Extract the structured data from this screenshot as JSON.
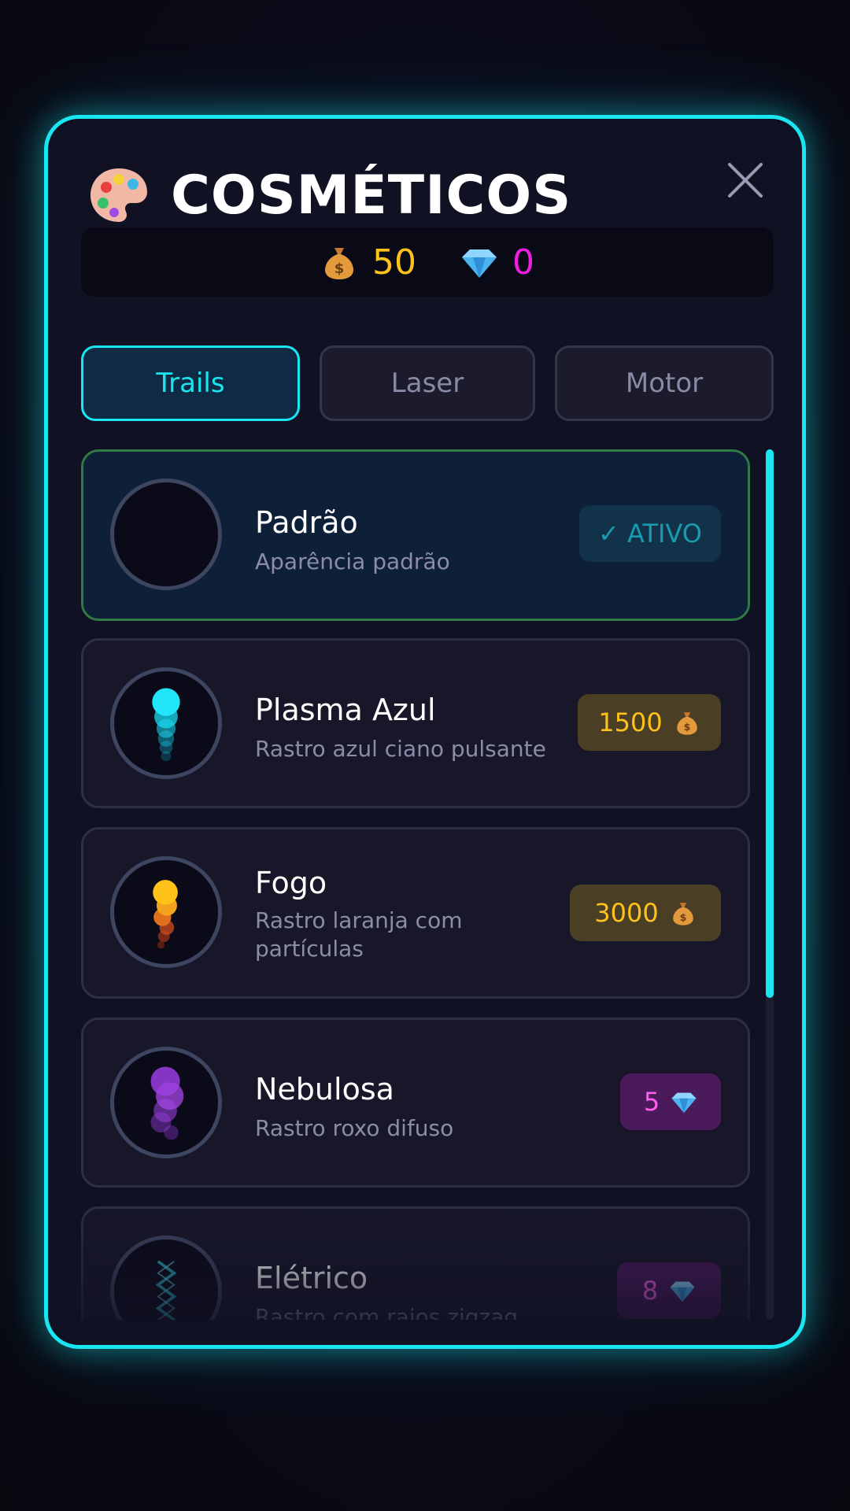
{
  "header": {
    "title": "COSMÉTICOS",
    "icon": "palette-icon",
    "close_icon": "close-icon"
  },
  "currency": {
    "coins": "50",
    "coins_icon": "money-bag-icon",
    "gems": "0",
    "gems_icon": "gem-icon"
  },
  "tabs": [
    {
      "label": "Trails",
      "active": true
    },
    {
      "label": "Laser",
      "active": false
    },
    {
      "label": "Motor",
      "active": false
    }
  ],
  "items": [
    {
      "name": "Padrão",
      "desc": "Aparência padrão",
      "price": "✓ ATIVO",
      "price_type": "owned",
      "active": true
    },
    {
      "name": "Plasma Azul",
      "desc": "Rastro azul ciano pulsante",
      "price": "1500",
      "price_type": "coins",
      "price_icon": "money-bag-icon"
    },
    {
      "name": "Fogo",
      "desc": "Rastro laranja com partículas",
      "price": "3000",
      "price_type": "coins",
      "price_icon": "money-bag-icon"
    },
    {
      "name": "Nebulosa",
      "desc": "Rastro roxo difuso",
      "price": "5",
      "price_type": "gems",
      "price_icon": "gem-icon"
    },
    {
      "name": "Elétrico",
      "desc": "Rastro com raios zigzag",
      "price": "8",
      "price_type": "gems",
      "price_icon": "gem-icon"
    }
  ],
  "colors": {
    "accent": "#19e6f0",
    "coins": "#ffc21a",
    "gems": "#ee1fe0",
    "active_border": "#2f7a45"
  },
  "scroll": {
    "position_fraction": 0.0,
    "visible_fraction": 0.63
  }
}
